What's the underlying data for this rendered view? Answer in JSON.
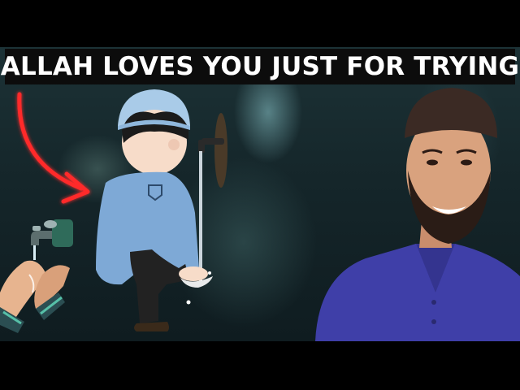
{
  "thumbnail": {
    "headline": "ALLAH LOVES YOU JUST FOR TRYING"
  },
  "colors": {
    "background": "#1a2c30",
    "headline_bar": "#0c0c0c",
    "headline_text": "#ffffff",
    "arrow": "#ff2a2a",
    "boy_shirt": "#7ea9d6",
    "boy_cap": "#a9cbe8",
    "speaker_shirt": "#3f3fa8"
  },
  "icons": [
    "curved-arrow-icon",
    "faucet-icon",
    "cupped-hands-icon"
  ]
}
